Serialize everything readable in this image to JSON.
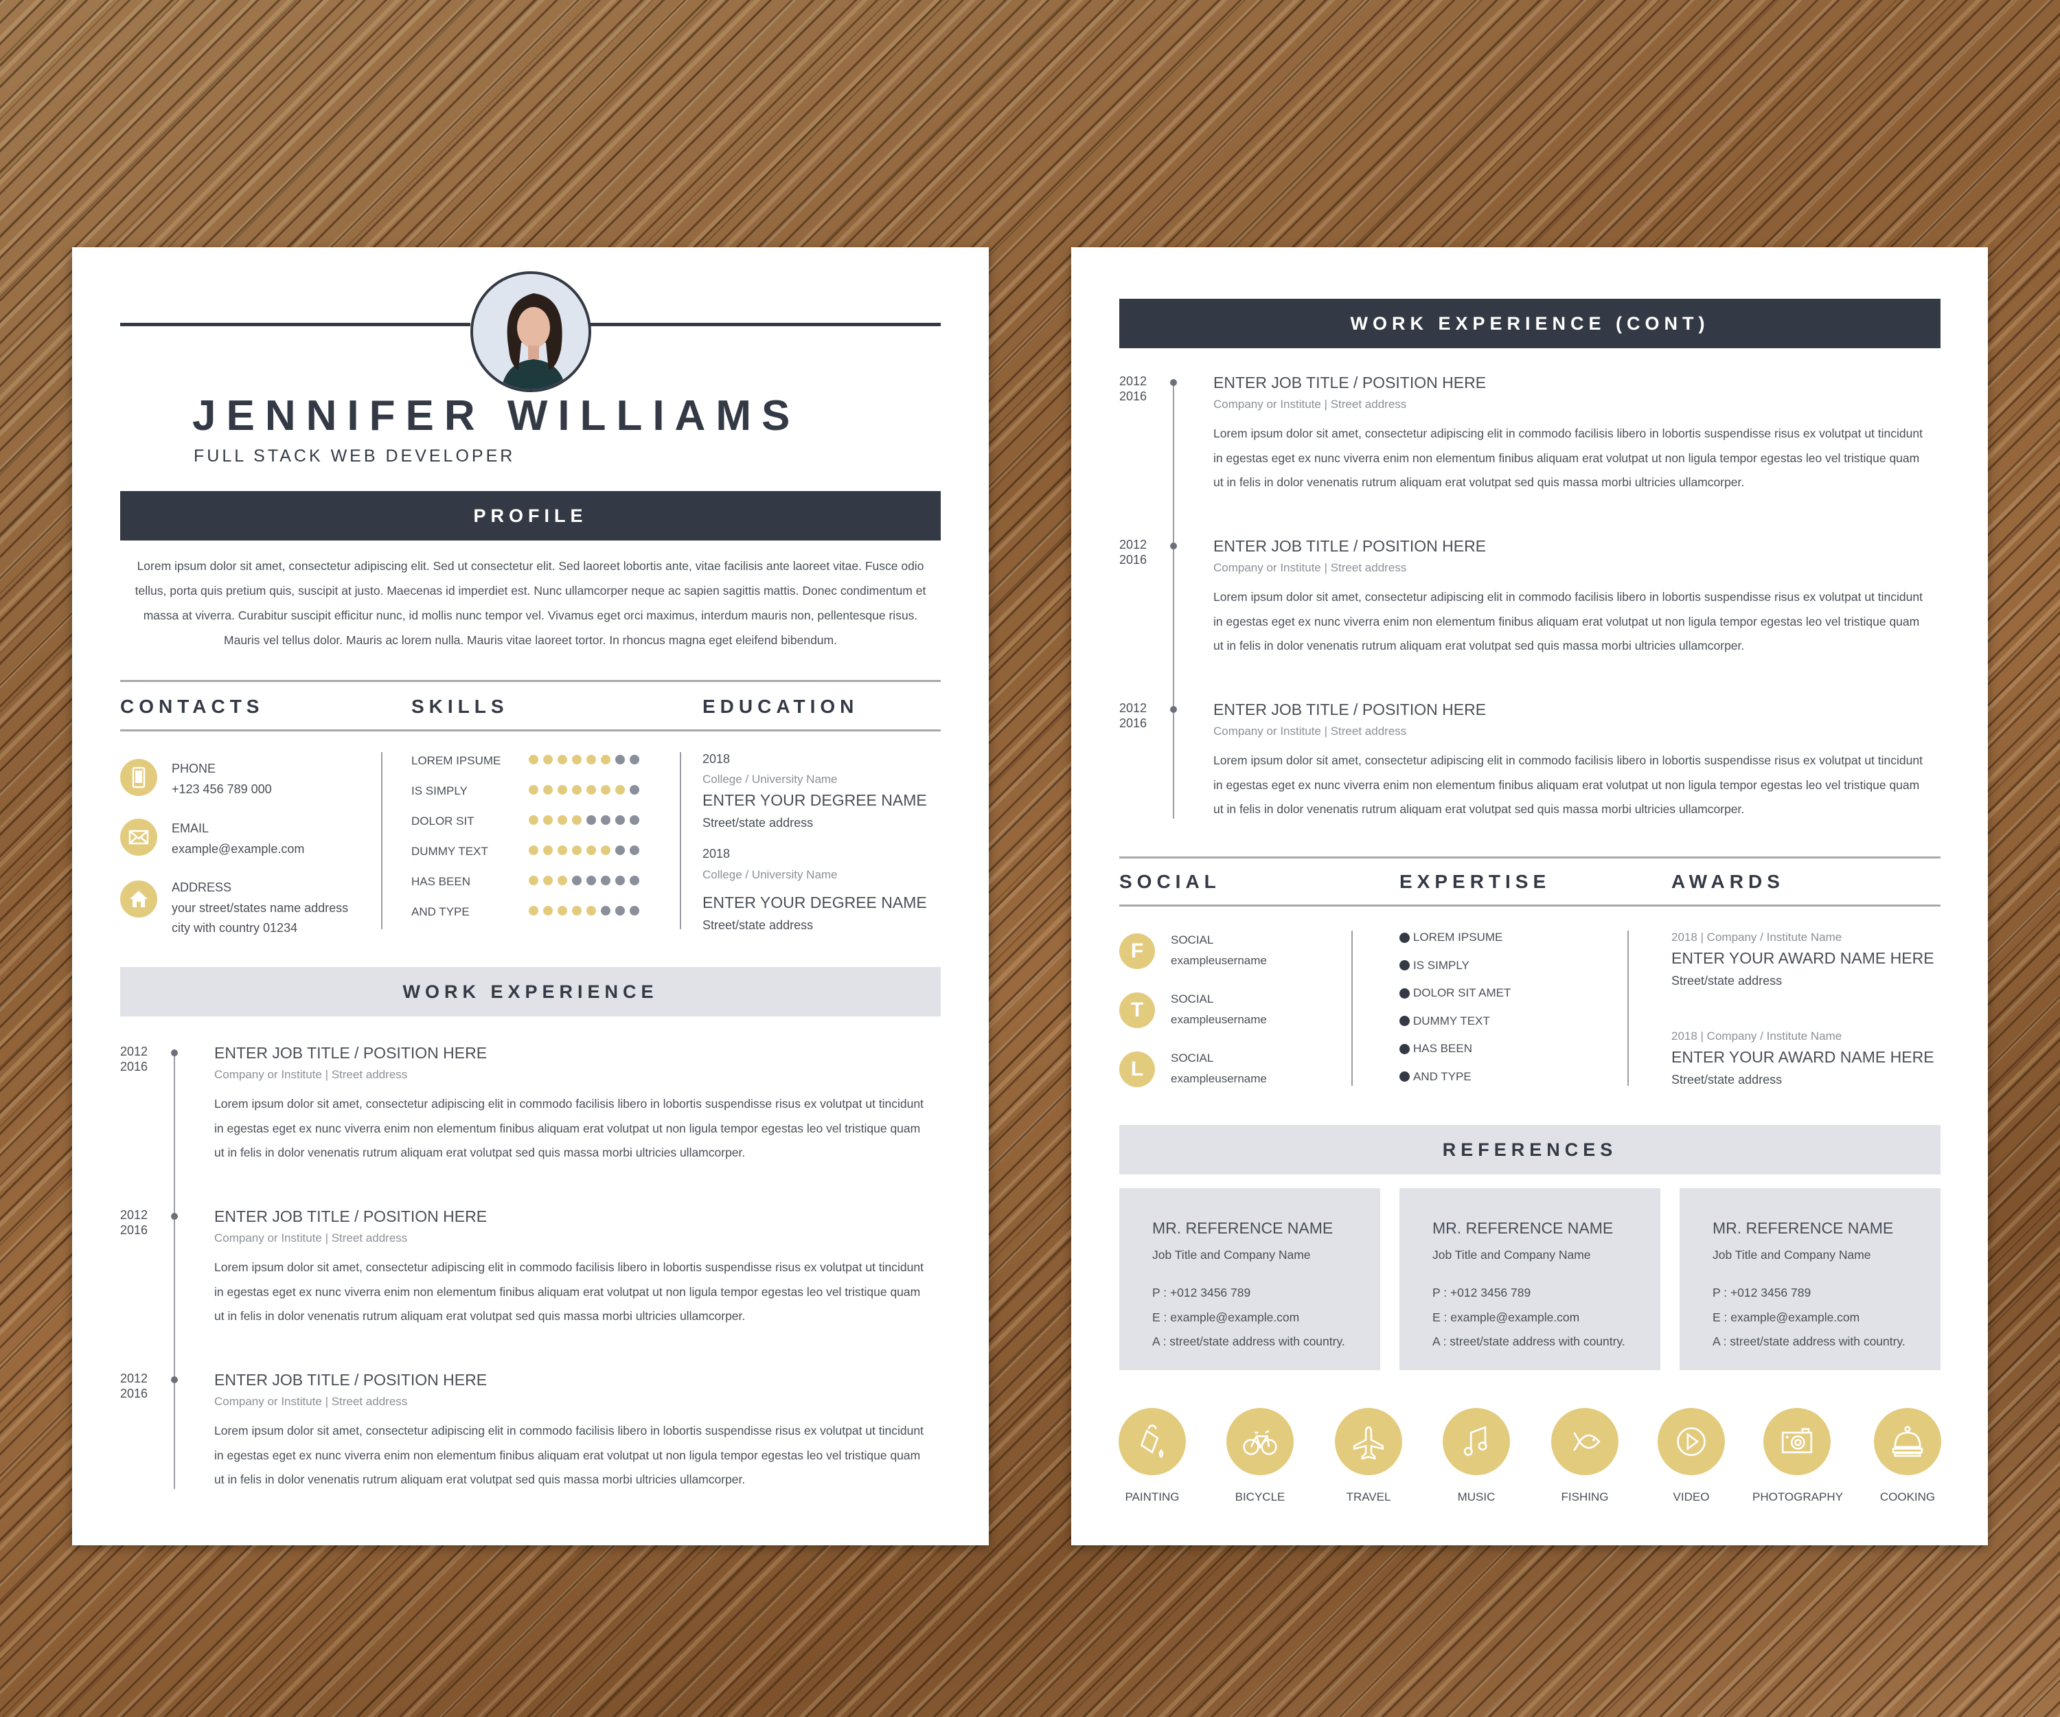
{
  "colors": {
    "dark": "#343a45",
    "accent": "#e3cb7e",
    "light_bar": "#e0e2e7",
    "dot_empty": "#8a8f9c"
  },
  "page1": {
    "name": "JENNIFER WILLIAMS",
    "subtitle": "FULL STACK WEB DEVELOPER",
    "avatar_icon": "profile-photo",
    "profile": {
      "heading": "PROFILE",
      "lines": [
        "Lorem ipsum dolor sit amet, consectetur adipiscing elit. Sed ut consectetur elit. Sed laoreet lobortis ante, vitae facilisis ante laoreet vitae. Fusce odio",
        "tellus, porta quis pretium quis, suscipit at justo. Maecenas id imperdiet est. Nunc ullamcorper neque ac sapien sagittis mattis. Donec condimentum et",
        "massa at viverra. Curabitur suscipit efficitur nunc, id mollis nunc tempor vel. Vivamus eget orci maximus, interdum mauris non, pellentesque risus.",
        "Mauris vel tellus dolor. Mauris ac lorem nulla. Mauris vitae laoreet tortor. In rhoncus magna eget eleifend bibendum."
      ]
    },
    "contacts": {
      "heading": "CONTACTS",
      "items": [
        {
          "icon": "phone-icon",
          "label": "PHONE",
          "value": "+123 456 789 000",
          "value2": ""
        },
        {
          "icon": "email-icon",
          "label": "EMAIL",
          "value": "example@example.com",
          "value2": ""
        },
        {
          "icon": "home-icon",
          "label": "ADDRESS",
          "value": "your street/states name address",
          "value2": "city with country 01234"
        }
      ]
    },
    "skills": {
      "heading": "SKILLS",
      "max": 8,
      "items": [
        {
          "name": "LOREM IPSUME",
          "level": 6
        },
        {
          "name": "IS SIMPLY",
          "level": 7
        },
        {
          "name": "DOLOR SIT",
          "level": 4
        },
        {
          "name": "DUMMY TEXT",
          "level": 6
        },
        {
          "name": "HAS BEEN",
          "level": 3
        },
        {
          "name": "AND TYPE",
          "level": 5
        }
      ]
    },
    "education": {
      "heading": "EDUCATION",
      "items": [
        {
          "year": "2018",
          "school": "College / University Name",
          "degree": "ENTER YOUR DEGREE NAME",
          "address": "Street/state address"
        },
        {
          "year": "2018",
          "school": "College / University Name",
          "degree": "ENTER YOUR DEGREE NAME",
          "address": "Street/state address"
        }
      ]
    },
    "work": {
      "heading": "WORK EXPERIENCE",
      "jobs": [
        {
          "start": "2012",
          "end": "2016",
          "title": "ENTER JOB TITLE / POSITION HERE",
          "company": "Company or Institute | Street address",
          "lines": [
            "Lorem ipsum dolor sit amet, consectetur adipiscing elit in commodo facilisis libero in lobortis suspendisse risus ex volutpat ut tincidunt",
            "in egestas eget ex nunc viverra enim non elementum finibus aliquam erat volutpat ut non ligula tempor egestas leo vel tristique quam",
            "ut in felis in dolor venenatis rutrum aliquam erat volutpat sed quis massa morbi ultricies ullamcorper."
          ]
        },
        {
          "start": "2012",
          "end": "2016",
          "title": "ENTER JOB TITLE / POSITION HERE",
          "company": "Company or Institute | Street address",
          "lines": [
            "Lorem ipsum dolor sit amet, consectetur adipiscing elit in commodo facilisis libero in lobortis suspendisse risus ex volutpat ut tincidunt",
            "in egestas eget ex nunc viverra enim non elementum finibus aliquam erat volutpat ut non ligula tempor egestas leo vel tristique quam",
            "ut in felis in dolor venenatis rutrum aliquam erat volutpat sed quis massa morbi ultricies ullamcorper."
          ]
        },
        {
          "start": "2012",
          "end": "2016",
          "title": "ENTER JOB TITLE / POSITION HERE",
          "company": "Company or Institute | Street address",
          "lines": [
            "Lorem ipsum dolor sit amet, consectetur adipiscing elit in commodo facilisis libero in lobortis suspendisse risus ex volutpat ut tincidunt",
            "in egestas eget ex nunc viverra enim non elementum finibus aliquam erat volutpat ut non ligula tempor egestas leo vel tristique quam",
            "ut in felis in dolor venenatis rutrum aliquam erat volutpat sed quis massa morbi ultricies ullamcorper."
          ]
        }
      ]
    }
  },
  "page2": {
    "work": {
      "heading": "WORK EXPERIENCE (CONT)",
      "jobs": [
        {
          "start": "2012",
          "end": "2016",
          "title": "ENTER JOB TITLE / POSITION HERE",
          "company": "Company or Institute | Street address",
          "lines": [
            "Lorem ipsum dolor sit amet, consectetur adipiscing elit in commodo facilisis libero in lobortis suspendisse risus ex volutpat ut tincidunt",
            "in egestas eget ex nunc viverra enim non elementum finibus aliquam erat volutpat ut non ligula tempor egestas leo vel tristique quam",
            "ut in felis in dolor venenatis rutrum aliquam erat volutpat sed quis massa morbi ultricies ullamcorper."
          ]
        },
        {
          "start": "2012",
          "end": "2016",
          "title": "ENTER JOB TITLE / POSITION HERE",
          "company": "Company or Institute | Street address",
          "lines": [
            "Lorem ipsum dolor sit amet, consectetur adipiscing elit in commodo facilisis libero in lobortis suspendisse risus ex volutpat ut tincidunt",
            "in egestas eget ex nunc viverra enim non elementum finibus aliquam erat volutpat ut non ligula tempor egestas leo vel tristique quam",
            "ut in felis in dolor venenatis rutrum aliquam erat volutpat sed quis massa morbi ultricies ullamcorper."
          ]
        },
        {
          "start": "2012",
          "end": "2016",
          "title": "ENTER JOB TITLE / POSITION HERE",
          "company": "Company or Institute | Street address",
          "lines": [
            "Lorem ipsum dolor sit amet, consectetur adipiscing elit in commodo facilisis libero in lobortis suspendisse risus ex volutpat ut tincidunt",
            "in egestas eget ex nunc viverra enim non elementum finibus aliquam erat volutpat ut non ligula tempor egestas leo vel tristique quam",
            "ut in felis in dolor venenatis rutrum aliquam erat volutpat sed quis massa morbi ultricies ullamcorper."
          ]
        }
      ]
    },
    "social": {
      "heading": "SOCIAL",
      "items": [
        {
          "letter": "F",
          "icon": "facebook-icon",
          "label": "SOCIAL",
          "value": "exampleusername"
        },
        {
          "letter": "T",
          "icon": "twitter-icon",
          "label": "SOCIAL",
          "value": "exampleusername"
        },
        {
          "letter": "L",
          "icon": "linkedin-icon",
          "label": "SOCIAL",
          "value": "exampleusername"
        }
      ]
    },
    "expertise": {
      "heading": "EXPERTISE",
      "items": [
        "LOREM IPSUME",
        "IS SIMPLY",
        "DOLOR SIT AMET",
        "DUMMY TEXT",
        "HAS BEEN",
        "AND TYPE"
      ]
    },
    "awards": {
      "heading": "AWARDS",
      "items": [
        {
          "meta": "2018 | Company / Institute Name",
          "name": "ENTER YOUR AWARD NAME HERE",
          "address": "Street/state address"
        },
        {
          "meta": "2018 | Company / Institute Name",
          "name": "ENTER YOUR AWARD NAME HERE",
          "address": "Street/state address"
        }
      ]
    },
    "references": {
      "heading": "REFERENCES",
      "items": [
        {
          "name": "MR. REFERENCE NAME",
          "job": "Job Title and Company Name",
          "phone": "P : +012 3456 789",
          "email": "E : example@example.com",
          "address": "A : street/state address with country."
        },
        {
          "name": "MR. REFERENCE NAME",
          "job": "Job Title and Company Name",
          "phone": "P : +012 3456 789",
          "email": "E : example@example.com",
          "address": "A : street/state address with country."
        },
        {
          "name": "MR. REFERENCE NAME",
          "job": "Job Title and Company Name",
          "phone": "P : +012 3456 789",
          "email": "E : example@example.com",
          "address": "A : street/state address with country."
        }
      ]
    },
    "hobbies": [
      {
        "label": "PAINTING",
        "icon": "paint-bucket-icon"
      },
      {
        "label": "BICYCLE",
        "icon": "bicycle-icon"
      },
      {
        "label": "TRAVEL",
        "icon": "airplane-icon"
      },
      {
        "label": "MUSIC",
        "icon": "music-note-icon"
      },
      {
        "label": "FISHING",
        "icon": "fish-icon"
      },
      {
        "label": "VIDEO",
        "icon": "play-icon"
      },
      {
        "label": "PHOTOGRAPHY",
        "icon": "camera-icon"
      },
      {
        "label": "COOKING",
        "icon": "cloche-icon"
      }
    ]
  }
}
